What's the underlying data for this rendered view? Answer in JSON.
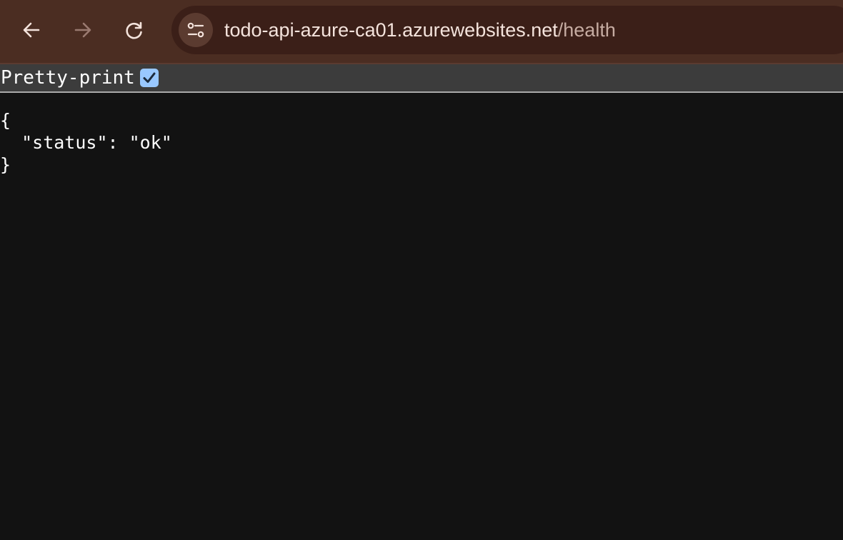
{
  "browser": {
    "url_host": "todo-api-azure-ca01.azurewebsites.net",
    "url_path": "/health",
    "icons": {
      "back": "arrow-left-icon",
      "forward": "arrow-right-icon",
      "reload": "reload-icon",
      "site_info": "tune-icon"
    }
  },
  "json_viewer": {
    "pretty_print_label": "Pretty-print",
    "pretty_print_checked": true,
    "lines": {
      "open": "{",
      "status_line": "  \"status\": \"ok\"",
      "close": "}"
    }
  }
}
